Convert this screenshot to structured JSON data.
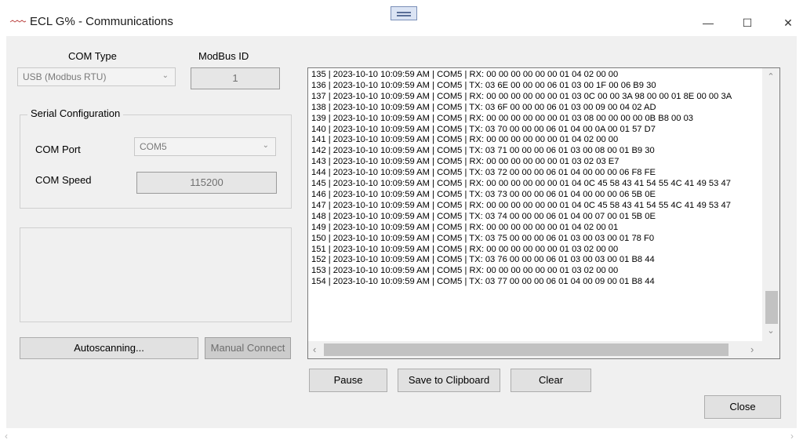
{
  "window": {
    "title": "ECL G% - Communications",
    "minimize_symbol": "—",
    "maximize_symbol": "☐",
    "close_symbol": "✕"
  },
  "connection": {
    "com_type_label": "COM Type",
    "com_type_value": "USB (Modbus RTU)",
    "modbus_id_label": "ModBus ID",
    "modbus_id_value": "1"
  },
  "serial": {
    "group_title": "Serial Configuration",
    "com_port_label": "COM Port",
    "com_port_value": "COM5",
    "com_speed_label": "COM Speed",
    "com_speed_value": "115200"
  },
  "buttons": {
    "autoscan": "Autoscanning...",
    "manual_connect": "Manual Connect",
    "pause": "Pause",
    "save_clipboard": "Save to Clipboard",
    "clear": "Clear",
    "close": "Close"
  },
  "log": [
    "135 | 2023-10-10 10:09:59 AM | COM5 | RX: 00 00 00 00 00 00 01 04 02 00 00",
    "136 | 2023-10-10 10:09:59 AM | COM5 | TX: 03 6E 00 00 00 06 01 03 00 1F 00 06 B9 30",
    "137 | 2023-10-10 10:09:59 AM | COM5 | RX: 00 00 00 00 00 00 01 03 0C 00 00 3A 98 00 00 01 8E 00 00 3A",
    "138 | 2023-10-10 10:09:59 AM | COM5 | TX: 03 6F 00 00 00 06 01 03 00 09 00 04 02 AD",
    "139 | 2023-10-10 10:09:59 AM | COM5 | RX: 00 00 00 00 00 00 01 03 08 00 00 00 00 0B B8 00 03",
    "140 | 2023-10-10 10:09:59 AM | COM5 | TX: 03 70 00 00 00 06 01 04 00 0A 00 01 57 D7",
    "141 | 2023-10-10 10:09:59 AM | COM5 | RX: 00 00 00 00 00 00 01 04 02 00 00",
    "142 | 2023-10-10 10:09:59 AM | COM5 | TX: 03 71 00 00 00 06 01 03 00 08 00 01 B9 30",
    "143 | 2023-10-10 10:09:59 AM | COM5 | RX: 00 00 00 00 00 00 01 03 02 03 E7",
    "144 | 2023-10-10 10:09:59 AM | COM5 | TX: 03 72 00 00 00 06 01 04 00 00 00 06 F8 FE",
    "145 | 2023-10-10 10:09:59 AM | COM5 | RX: 00 00 00 00 00 00 01 04 0C 45 58 43 41 54 55 4C 41 49 53 47",
    "146 | 2023-10-10 10:09:59 AM | COM5 | TX: 03 73 00 00 00 06 01 04 00 00 00 06 5B 0E",
    "147 | 2023-10-10 10:09:59 AM | COM5 | RX: 00 00 00 00 00 00 01 04 0C 45 58 43 41 54 55 4C 41 49 53 47",
    "148 | 2023-10-10 10:09:59 AM | COM5 | TX: 03 74 00 00 00 06 01 04 00 07 00 01 5B 0E",
    "149 | 2023-10-10 10:09:59 AM | COM5 | RX: 00 00 00 00 00 00 01 04 02 00 01",
    "150 | 2023-10-10 10:09:59 AM | COM5 | TX: 03 75 00 00 00 06 01 03 00 03 00 01 78 F0",
    "151 | 2023-10-10 10:09:59 AM | COM5 | RX: 00 00 00 00 00 00 01 03 02 00 00",
    "152 | 2023-10-10 10:09:59 AM | COM5 | TX: 03 76 00 00 00 06 01 03 00 03 00 01 B8 44",
    "153 | 2023-10-10 10:09:59 AM | COM5 | RX: 00 00 00 00 00 00 01 03 02 00 00",
    "154 | 2023-10-10 10:09:59 AM | COM5 | TX: 03 77 00 00 00 06 01 04 00 09 00 01 B8 44"
  ],
  "icons": {
    "app": "app-logo-icon",
    "drag": "drag-handle-icon",
    "chevron": "chevron-down-icon"
  }
}
